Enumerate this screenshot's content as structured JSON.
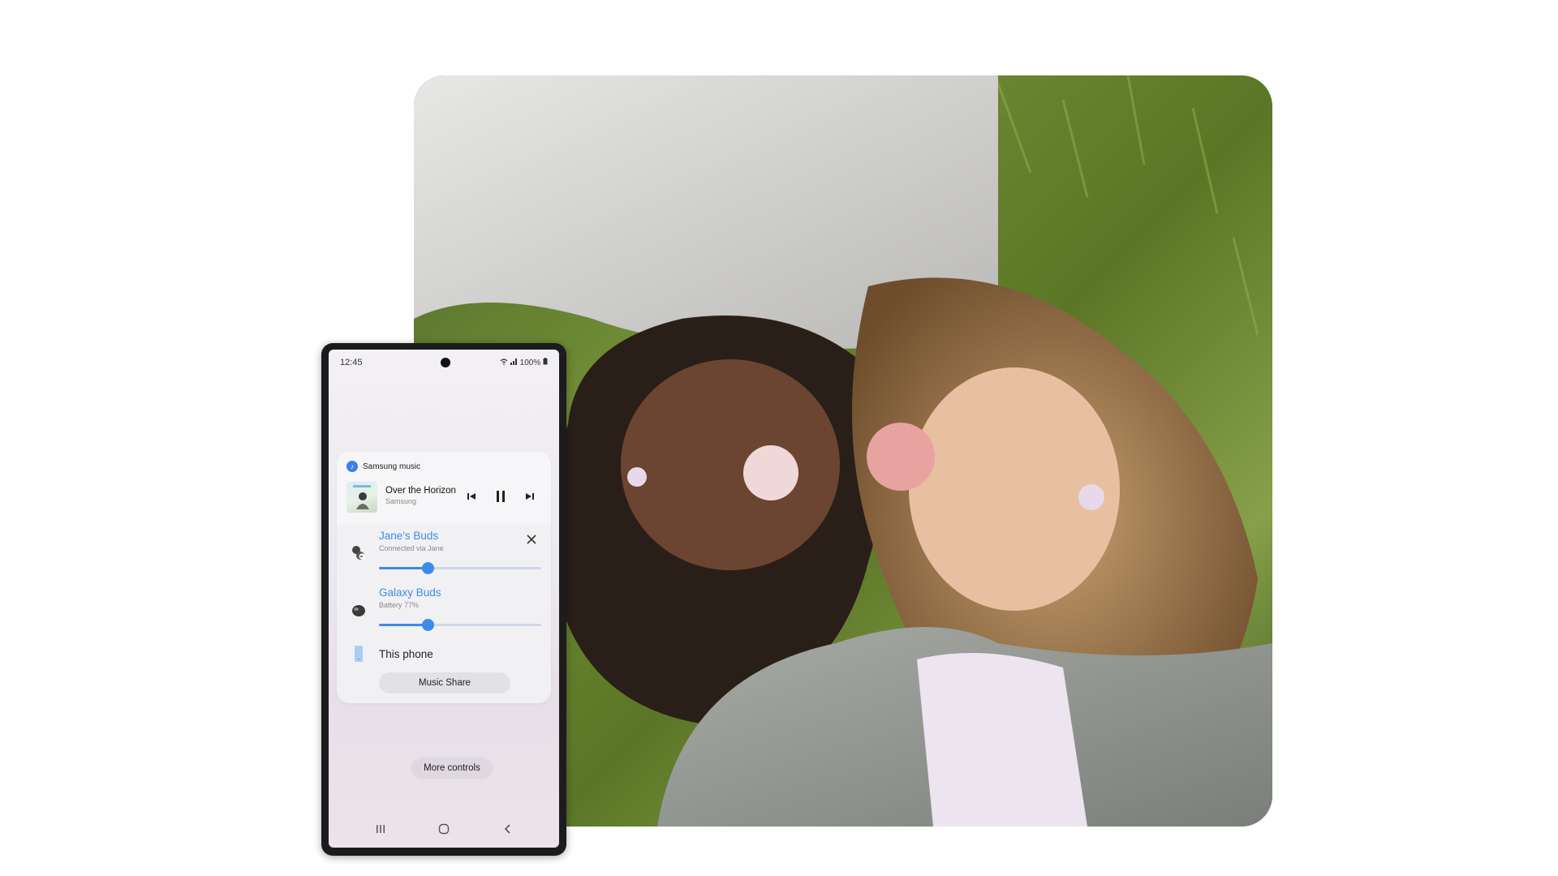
{
  "status_bar": {
    "time": "12:45",
    "indicators": "100%"
  },
  "media_panel": {
    "app_name": "Samsung music",
    "track_title": "Over the Horizon",
    "track_artist": "Samsung",
    "icons": [
      "previous-icon",
      "pause-icon",
      "next-icon"
    ]
  },
  "devices": [
    {
      "name": "Jane's Buds",
      "subtitle": "Connected via Jane",
      "volume": 0.3,
      "active": true
    },
    {
      "name": "Galaxy Buds",
      "subtitle": "Battery 77%",
      "volume": 0.3,
      "active": true
    },
    {
      "name": "This phone",
      "subtitle": "",
      "active": false
    }
  ],
  "buttons": {
    "music_share": "Music Share",
    "more_controls": "More controls"
  },
  "nav": [
    "recents-icon",
    "home-icon",
    "back-icon"
  ],
  "colors": {
    "accent": "#3d8be8",
    "panel": "#f6f6f8"
  }
}
